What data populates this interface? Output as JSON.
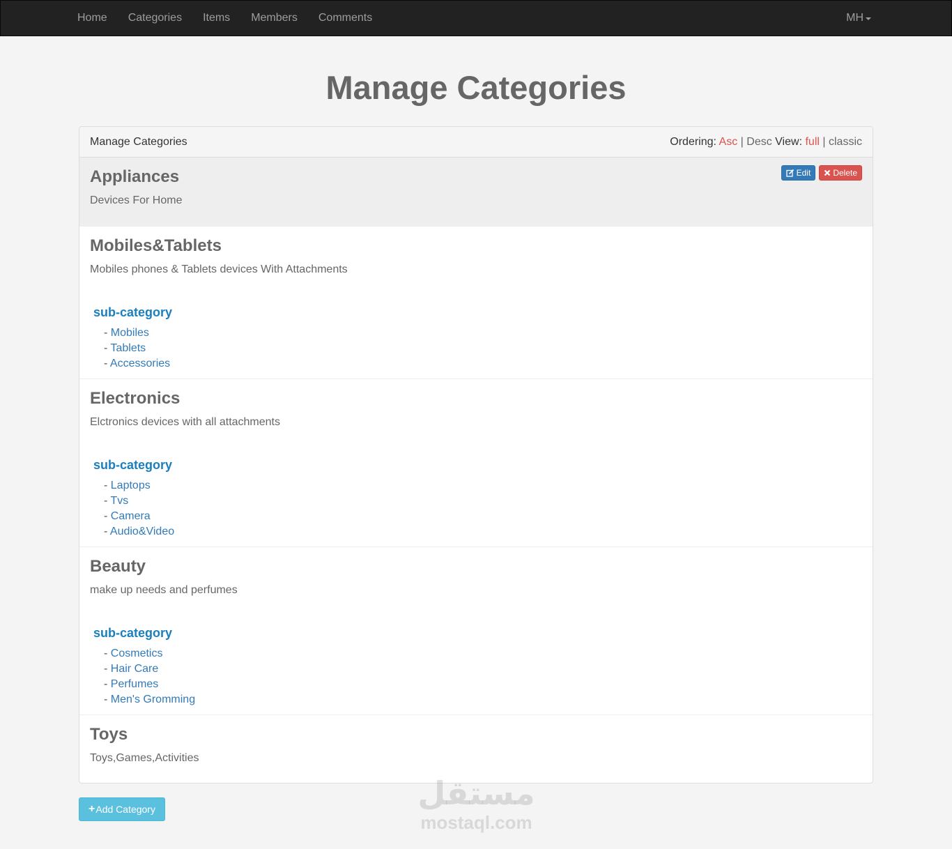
{
  "navbar": {
    "links": [
      "Home",
      "Categories",
      "Items",
      "Members",
      "Comments"
    ],
    "user": "MH"
  },
  "page_title": "Manage Categories",
  "panel": {
    "heading": "Manage Categories",
    "ordering_label": "Ordering:",
    "asc": "Asc",
    "desc": "Desc",
    "view_label": "View:",
    "full": "full",
    "classic": "classic",
    "sep": "|"
  },
  "actions": {
    "edit": "Edit",
    "delete": "Delete"
  },
  "sub_category_label": "sub-category",
  "categories": [
    {
      "name": "Appliances",
      "description": "Devices For Home",
      "subs": []
    },
    {
      "name": "Mobiles&Tablets",
      "description": "Mobiles phones & Tablets devices With Attachments",
      "subs": [
        "Mobiles",
        "Tablets",
        "Accessories"
      ]
    },
    {
      "name": "Electronics",
      "description": "Elctronics devices with all attachments",
      "subs": [
        "Laptops",
        "Tvs",
        "Camera",
        "Audio&Video"
      ]
    },
    {
      "name": "Beauty",
      "description": "make up needs and perfumes",
      "subs": [
        "Cosmetics",
        "Hair Care",
        "Perfumes",
        "Men's Gromming"
      ]
    },
    {
      "name": "Toys",
      "description": "Toys,Games,Activities",
      "subs": []
    }
  ],
  "add_button": "Add Category",
  "watermark": {
    "arabic": "مستقل",
    "latin": "mostaql.com"
  },
  "colors": {
    "accent": "#d9534f",
    "link": "#337ab7",
    "sub_title": "#1b7fbd",
    "info": "#5bc0de"
  }
}
